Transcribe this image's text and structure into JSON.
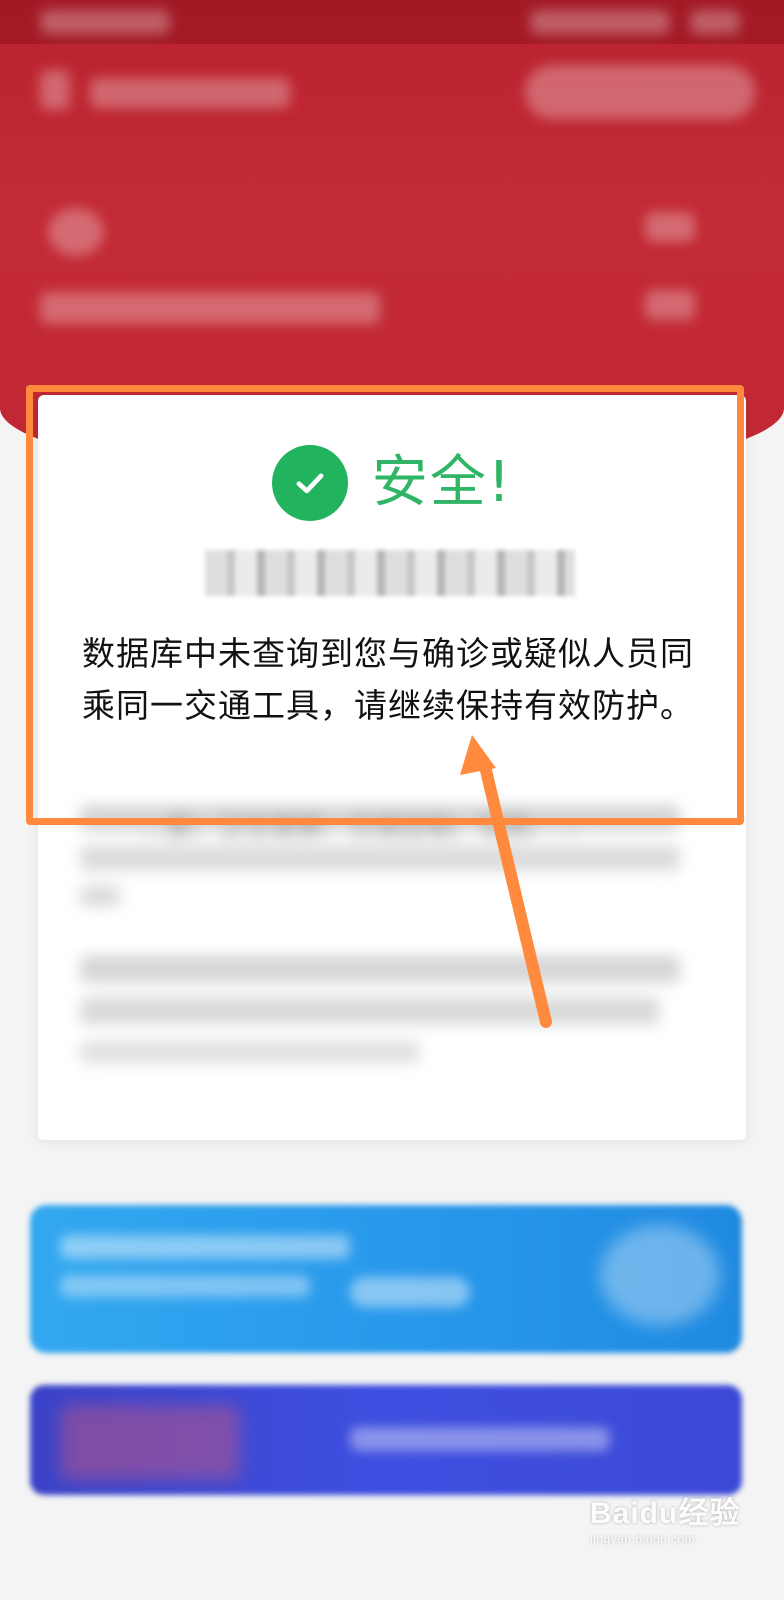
{
  "colors": {
    "header_red": "#c22a35",
    "safe_green": "#2fb565",
    "highlight_orange": "#ff8a3d",
    "banner_blue": "#2796ea",
    "banner_indigo": "#3d4ee0"
  },
  "result": {
    "icon": "check-circle-icon",
    "status": "安全!",
    "message": "数据库中未查询到您与确诊或疑似人员同乘同一交通工具，请继续保持有效防护。"
  },
  "blurred_fragment": "…委、卫生健康、交通运输、铁路、…",
  "watermark": {
    "brand": "Baidu经验",
    "site": "jingyan.baidu.com"
  }
}
